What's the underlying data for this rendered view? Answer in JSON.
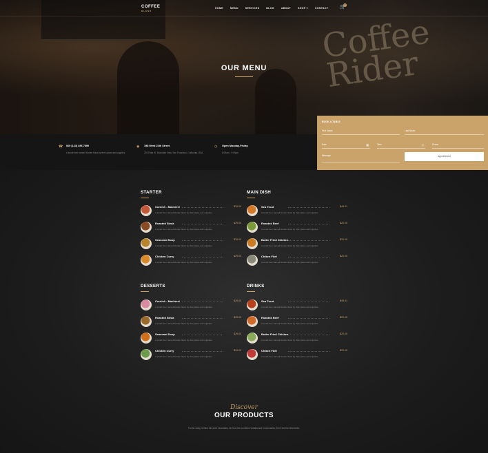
{
  "brand": {
    "name": "COFFEE",
    "tagline": "BLEND"
  },
  "nav": {
    "items": [
      "HOME",
      "MENU",
      "SERVICES",
      "BLOG",
      "ABOUT",
      "SHOP ▾",
      "CONTACT"
    ],
    "cart_count": "0"
  },
  "hero": {
    "title": "OUR MENU",
    "wall_sign": "Coffee Rider"
  },
  "info": [
    {
      "icon": "phone-icon",
      "glyph": "☎",
      "title": "000 (123) 456 7890",
      "desc": "A small river named Duden flows by their place and supplies."
    },
    {
      "icon": "location-icon",
      "glyph": "◉",
      "title": "198 West 21th Street",
      "desc": "203 Fake St. Mountain View, San Francisco, California, USA"
    },
    {
      "icon": "clock-icon",
      "glyph": "◷",
      "title": "Open Monday-Friday",
      "desc": "8:00am - 9:00pm"
    }
  ],
  "booking": {
    "title": "BOOK A TABLE",
    "first_name": "First Name",
    "last_name": "Last Name",
    "date": "Date",
    "time": "Time",
    "phone": "Phone",
    "message": "Message",
    "button": "Appointment",
    "accent": "#c9a36a"
  },
  "menu": {
    "starter": {
      "title": "STARTER",
      "items": [
        {
          "name": "Cornish - Mackerel",
          "price": "$29.00",
          "desc": "A small river named Duden flows by their place and supplies.",
          "color": "#c25a3a"
        },
        {
          "name": "Roasted Steak",
          "price": "$29.00",
          "desc": "A small river named Duden flows by their place and supplies.",
          "color": "#8a4a22"
        },
        {
          "name": "Seasonal Soup",
          "price": "$29.00",
          "desc": "A small river named Duden flows by their place and supplies.",
          "color": "#b8852e"
        },
        {
          "name": "Chicken Curry",
          "price": "$29.00",
          "desc": "A small river named Duden flows by their place and supplies.",
          "color": "#d9892a"
        }
      ]
    },
    "main_dish": {
      "title": "MAIN DISH",
      "items": [
        {
          "name": "Sea Trout",
          "price": "$49.91",
          "desc": "A small river named Duden flows by their place and supplies.",
          "color": "#d27a2a"
        },
        {
          "name": "Roasted Beef",
          "price": "$20.00",
          "desc": "A small river named Duden flows by their place and supplies.",
          "color": "#7a9a3a"
        },
        {
          "name": "Butter Fried Chicken",
          "price": "$20.00",
          "desc": "A small river named Duden flows by their place and supplies.",
          "color": "#c97a22"
        },
        {
          "name": "Chiken Filet",
          "price": "$20.00",
          "desc": "A small river named Duden flows by their place and supplies.",
          "color": "#8a8a7a"
        }
      ]
    },
    "desserts": {
      "title": "DESSERTS",
      "items": [
        {
          "name": "Cornish - Mackerel",
          "price": "$29.00",
          "desc": "A small river named Duden flows by their place and supplies.",
          "color": "#d88aa0"
        },
        {
          "name": "Roasted Steak",
          "price": "$29.00",
          "desc": "A small river named Duden flows by their place and supplies.",
          "color": "#9a6a2a"
        },
        {
          "name": "Seasonal Soup",
          "price": "$29.00",
          "desc": "A small river named Duden flows by their place and supplies.",
          "color": "#d0701a"
        },
        {
          "name": "Chicken Curry",
          "price": "$29.00",
          "desc": "A small river named Duden flows by their place and supplies.",
          "color": "#6a9a4a"
        }
      ]
    },
    "drinks": {
      "title": "DRINKS",
      "items": [
        {
          "name": "Sea Trout",
          "price": "$49.91",
          "desc": "A small river named Duden flows by their place and supplies.",
          "color": "#b8401a"
        },
        {
          "name": "Roasted Beef",
          "price": "$20.00",
          "desc": "A small river named Duden flows by their place and supplies.",
          "color": "#d06a2a"
        },
        {
          "name": "Butter Fried Chicken",
          "price": "$20.00",
          "desc": "A small river named Duden flows by their place and supplies.",
          "color": "#8aaa5a"
        },
        {
          "name": "Chiken Filet",
          "price": "$20.00",
          "desc": "A small river named Duden flows by their place and supplies.",
          "color": "#c03a3a"
        }
      ]
    }
  },
  "products": {
    "script": "Discover",
    "title": "OUR PRODUCTS",
    "desc": "Far far away, behind the word mountains, far from the countries Vokalia and Consonantia, there live the blind texts."
  }
}
